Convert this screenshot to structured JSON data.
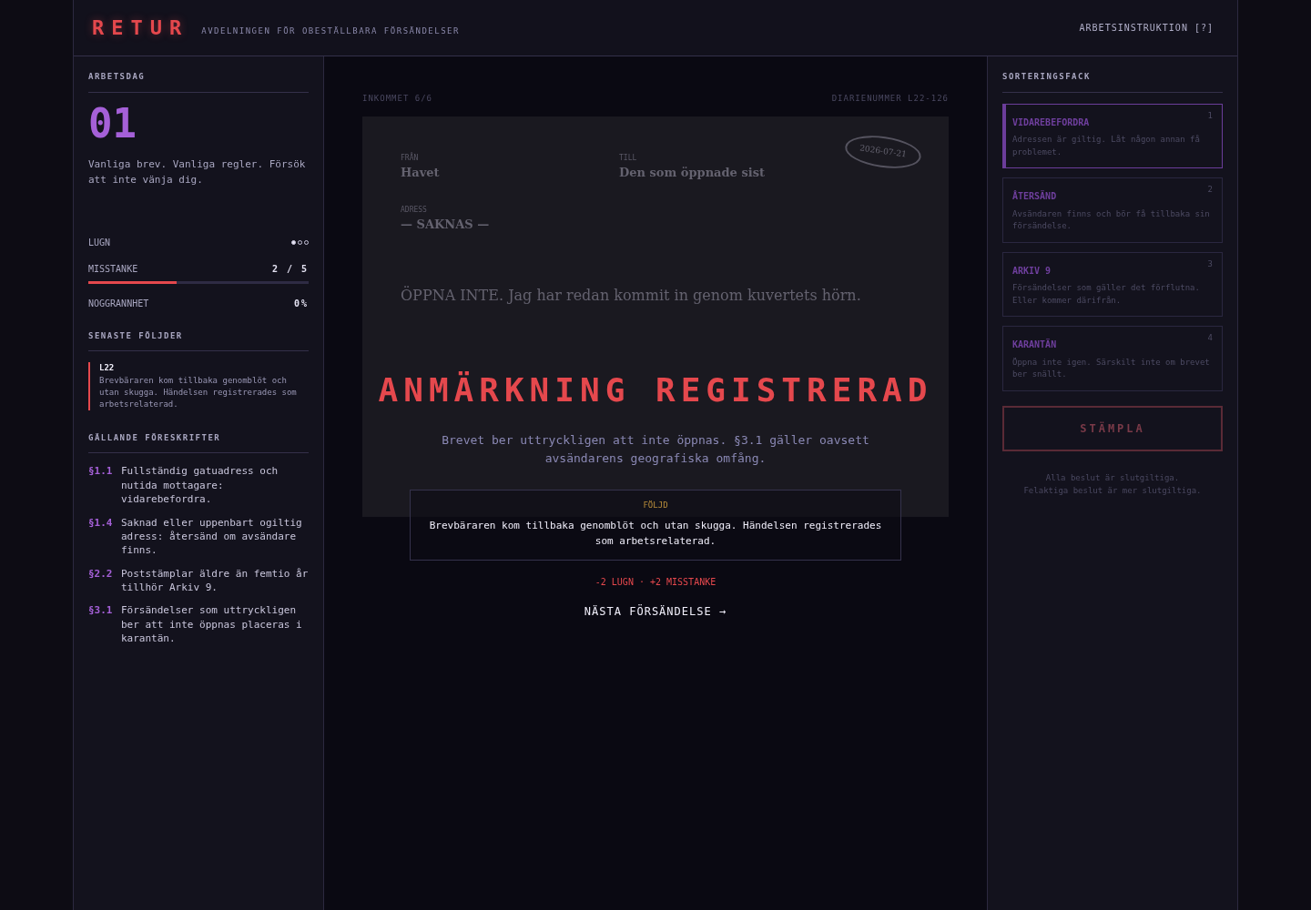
{
  "header": {
    "logo": "RETUR",
    "subtitle": "AVDELNINGEN FÖR OBESTÄLLBARA FÖRSÄNDELSER",
    "help_link": "ARBETSINSTRUKTION [?]"
  },
  "workday": {
    "heading": "ARBETSDAG",
    "number": "01",
    "description": "Vanliga brev. Vanliga regler. Försök att inte vänja dig."
  },
  "stats": [
    {
      "kind": "dots",
      "label": "LUGN",
      "dots": [
        {
          "filled": true
        },
        {
          "filled": false
        },
        {
          "filled": false
        }
      ]
    },
    {
      "kind": "bar",
      "label": "MISSTANKE",
      "reading": "2 / 5",
      "level": 0.4
    },
    {
      "kind": "value",
      "label": "NOGGRANNHET",
      "reading": "0%"
    }
  ],
  "recent_consequences": {
    "heading": "SENASTE FÖLJDER",
    "items": [
      {
        "code": "L22",
        "text": "Brevbäraren kom tillbaka genomblöt och utan skugga. Händelsen registrerades som arbetsrelaterad."
      }
    ]
  },
  "regulations": {
    "heading": "GÄLLANDE FÖRESKRIFTER",
    "items": [
      {
        "code": "§1.1",
        "text": "Fullständig gatuadress och nutida mottagare: vidarebefordra."
      },
      {
        "code": "§1.4",
        "text": "Saknad eller uppenbart ogiltig adress: återsänd om avsändare finns."
      },
      {
        "code": "§2.2",
        "text": "Poststämplar äldre än femtio år tillhör Arkiv 9."
      },
      {
        "code": "§3.1",
        "text": "Försändelser som uttryckligen ber att inte öppnas placeras i karantän."
      }
    ]
  },
  "desk": {
    "counter": "INKOMMET 6/6",
    "diary_number": "DIARIENUMMER L22-126",
    "letter": {
      "postmark": "2026-07-21",
      "fields": [
        {
          "label": "FRÅN",
          "value": "Havet"
        },
        {
          "label": "TILL",
          "value": "Den som öppnade sist"
        },
        {
          "label": "ADRESS",
          "value": "— SAKNAS —"
        }
      ],
      "message": "ÖPPNA INTE. Jag har redan kommit in genom kuvertets hörn."
    }
  },
  "verdict": {
    "title": "ANMÄRKNING REGISTRERAD",
    "explanation": "Brevet ber uttryckligen att inte öppnas. §3.1 gäller oavsett avsändarens geografiska omfång.",
    "consequence": {
      "label": "FÖLJD",
      "text": "Brevbäraren kom tillbaka genomblöt och utan skugga. Händelsen registrerades som arbetsrelaterad."
    },
    "effects": "-2 LUGN · +2 MISSTANKE",
    "next_button": "NÄSTA FÖRSÄNDELSE →"
  },
  "sorting": {
    "heading": "SORTERINGSFACK",
    "bins": [
      {
        "title": "VIDAREBEFORDRA",
        "description": "Adressen är giltig. Låt någon annan få problemet.",
        "key": "1",
        "selected": true
      },
      {
        "title": "ÅTERSÄND",
        "description": "Avsändaren finns och bör få tillbaka sin försändelse.",
        "key": "2",
        "selected": false
      },
      {
        "title": "ARKIV 9",
        "description": "Försändelser som gäller det förflutna. Eller kommer därifrån.",
        "key": "3",
        "selected": false
      },
      {
        "title": "KARANTÄN",
        "description": "Öppna inte igen. Särskilt inte om brevet ber snällt.",
        "key": "4",
        "selected": false
      }
    ],
    "stamp_button": {
      "label": "STÄMPLA",
      "disabled": true
    },
    "footer": [
      "Alla beslut är slutgiltiga.",
      "Felaktiga beslut är mer slutgiltiga."
    ]
  }
}
